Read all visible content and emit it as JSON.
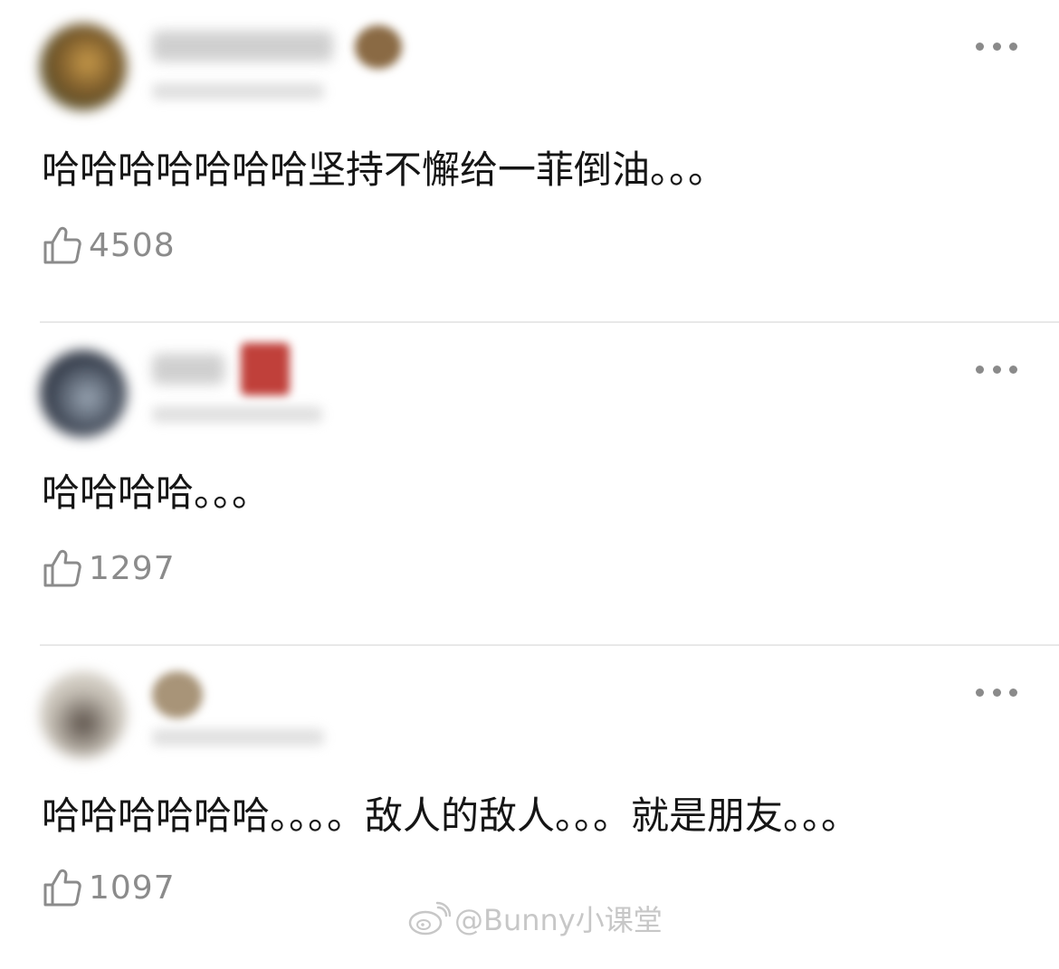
{
  "comments": [
    {
      "text": "哈哈哈哈哈哈哈坚持不懈给一菲倒油。。。",
      "likes": "4508"
    },
    {
      "text": "哈哈哈哈。。。",
      "likes": "1297"
    },
    {
      "text": "哈哈哈哈哈哈。。。。敌人的敌人。。。就是朋友。。。",
      "likes": "1097"
    }
  ],
  "watermark": "@Bunny小课堂",
  "icons": {
    "like": "thumbs-up-icon",
    "more": "more-options-icon",
    "watermark": "weibo-logo-icon"
  }
}
